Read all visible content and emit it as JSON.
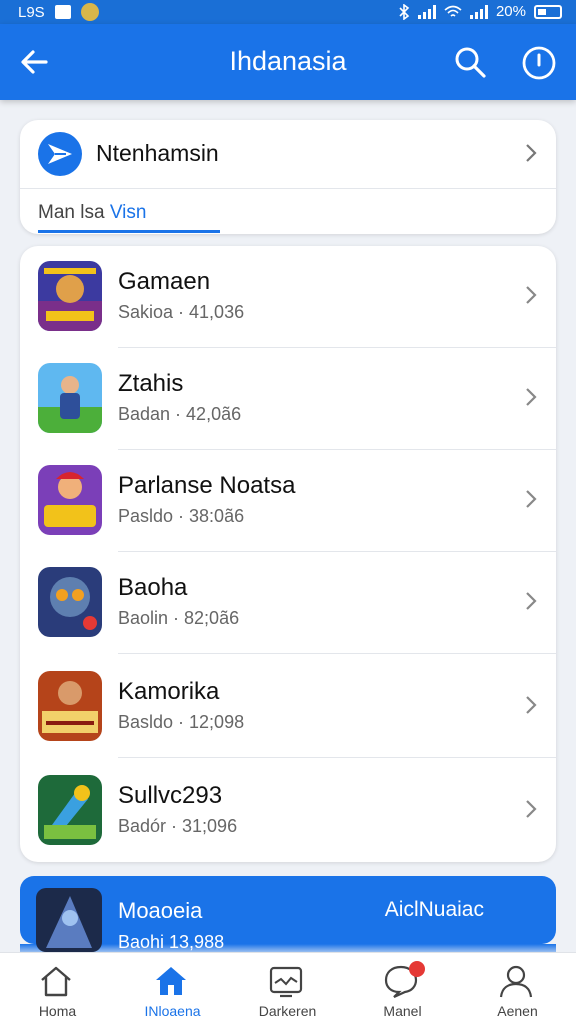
{
  "status_bar": {
    "left_text": "L9S",
    "battery_text": "20%",
    "icons": [
      "mail-icon",
      "app-icon",
      "bluetooth-icon",
      "signal-icon",
      "wifi-icon",
      "battery-icon"
    ]
  },
  "app_bar": {
    "title": "Ihdanasia",
    "icons": [
      "back-arrow-icon",
      "search-icon",
      "info-icon"
    ]
  },
  "top_card": {
    "name": "Ntenhamsin",
    "tab_prefix": "Man lsa ",
    "tab_highlight": "Visn"
  },
  "list": [
    {
      "name": "Gamaen",
      "sub": "Sakioa · 41,036",
      "icon": "game-icon-1"
    },
    {
      "name": "Ztahis",
      "sub": "Badan · 42,0ã6",
      "icon": "game-icon-2"
    },
    {
      "name": "Parlanse Noatsa",
      "sub": "Pasldo · 38:0ã6",
      "icon": "game-icon-3"
    },
    {
      "name": "Baoha",
      "sub": "Baolin · 82;0ã6",
      "icon": "game-icon-4"
    },
    {
      "name": "Kamorika",
      "sub": "Basldo · 12;098",
      "icon": "game-icon-5"
    },
    {
      "name": "Sullvc293",
      "sub": "Badór · 31;096",
      "icon": "game-icon-6"
    }
  ],
  "promo": {
    "name": "Moaoeia",
    "action": "AiclNuaiac",
    "sub": "Baohi  13,988"
  },
  "bottom_nav": [
    {
      "label": "Homa",
      "icon": "home-outline-icon",
      "active": false
    },
    {
      "label": "INloaena",
      "icon": "home-filled-icon",
      "active": true
    },
    {
      "label": "Darkeren",
      "icon": "monitor-icon",
      "active": false
    },
    {
      "label": "Manel",
      "icon": "chat-icon",
      "active": false
    },
    {
      "label": "Aenen",
      "icon": "profile-icon",
      "active": false
    }
  ],
  "colors": {
    "primary": "#1a73e8",
    "notification": "#e53935"
  }
}
